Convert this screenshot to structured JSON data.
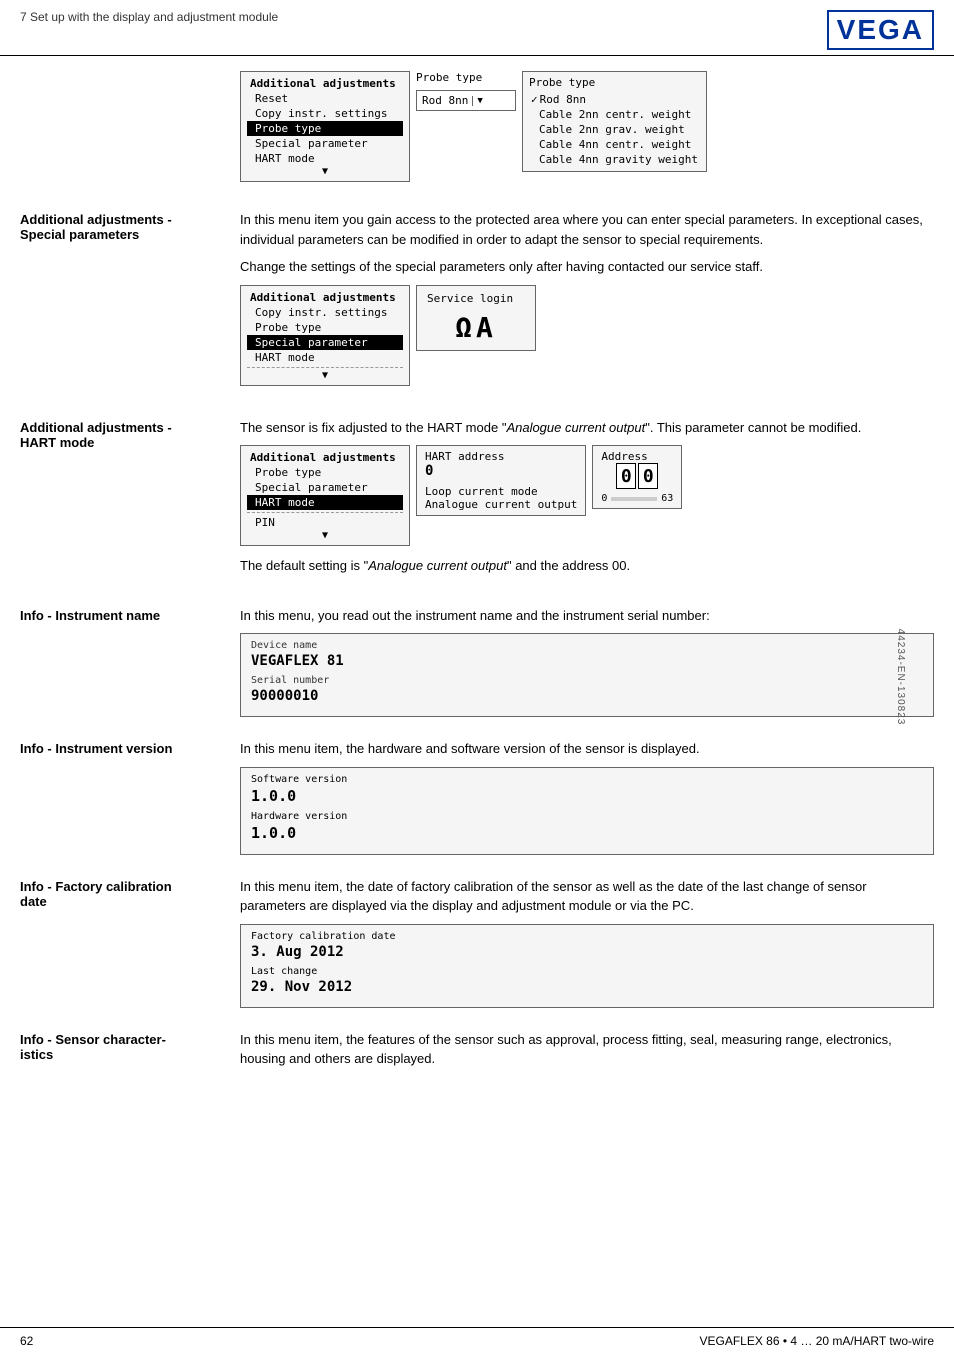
{
  "header": {
    "breadcrumb": "7 Set up with the display and adjustment module",
    "logo": "VEGA"
  },
  "sections": [
    {
      "id": "probe-type",
      "label": "",
      "body_paragraphs": [],
      "has_ui": true,
      "ui_type": "probe-type-row"
    },
    {
      "id": "special-parameters",
      "label_line1": "Additional adjustments -",
      "label_line2": "Special parameters",
      "paragraphs": [
        "In this menu item you gain access to the protected area where you can enter special parameters. In exceptional cases, individual parameters can be modified in order to adapt the sensor to special requirements.",
        "Change the settings of the special parameters only after having contacted our service staff."
      ],
      "has_ui": true,
      "ui_type": "service-login-row"
    },
    {
      "id": "hart-mode",
      "label_line1": "Additional adjustments -",
      "label_line2": "HART mode",
      "paragraphs": [
        "The sensor is fix adjusted to the HART mode \"Analogue current output\". This parameter cannot be modified."
      ],
      "has_ui": true,
      "ui_type": "hart-row",
      "note": "The default setting is \"Analogue current output\" and the address 00."
    },
    {
      "id": "instrument-name",
      "label": "Info - Instrument name",
      "paragraphs": [
        "In this menu, you read out the instrument name and the instrument serial number:"
      ],
      "has_ui": true,
      "ui_type": "device-name-row"
    },
    {
      "id": "instrument-version",
      "label": "Info - Instrument version",
      "paragraphs": [
        "In this menu item, the hardware and software version of the sensor is displayed."
      ],
      "has_ui": true,
      "ui_type": "version-row"
    },
    {
      "id": "factory-cal",
      "label_line1": "Info - Factory calibration",
      "label_line2": "date",
      "paragraphs": [
        "In this menu item, the date of factory calibration of the sensor as well as the date of the last change of sensor parameters are displayed via the display and adjustment module or via the PC."
      ],
      "has_ui": true,
      "ui_type": "calibration-row"
    },
    {
      "id": "sensor-char",
      "label_line1": "Info - Sensor character-",
      "label_line2": "istics",
      "paragraphs": [
        "In this menu item, the features of the sensor such as approval, process fitting, seal, measuring range, electronics, housing and others are displayed."
      ],
      "has_ui": false
    }
  ],
  "probe_type_menu": {
    "title": "Additional adjustments",
    "items": [
      "Reset",
      "Copy instr. settings",
      "Probe type",
      "Special parameter",
      "HART mode"
    ],
    "selected": "Probe type"
  },
  "probe_type_center": {
    "label": "Probe type",
    "value": "Rod 8nn"
  },
  "probe_type_options": {
    "label": "Probe type",
    "options": [
      "Rod 8nn",
      "Cable 2nn centr. weight",
      "Cable 2nn grav. weight",
      "Cable 4nn centr. weight",
      "Cable 4nn gravity weight"
    ],
    "checked": "Rod 8nn"
  },
  "service_menu": {
    "title": "Additional adjustments",
    "items": [
      "Copy instr. settings",
      "Probe type",
      "Special parameter",
      "HART mode"
    ],
    "selected": "Special parameter",
    "divider": true
  },
  "service_login": {
    "label": "Service login",
    "icon": "ᴮᴬ",
    "icon_display": "ΩA"
  },
  "hart_menu": {
    "title": "Additional adjustments",
    "items": [
      "Probe type",
      "Special parameter",
      "HART mode"
    ],
    "selected": "HART mode",
    "extra": "PIN"
  },
  "hart_center": {
    "label": "HART address",
    "value": "0",
    "sub_items": [
      "Loop current mode",
      "Analogue current output"
    ]
  },
  "hart_address": {
    "label": "Address",
    "digits": [
      "0",
      "0"
    ],
    "slider_min": "0",
    "slider_max": "63"
  },
  "device_name": {
    "name_label": "Device name",
    "name_value": "VEGAFLEX 81",
    "serial_label": "Serial number",
    "serial_value": "90000010"
  },
  "version": {
    "sw_label": "Software version",
    "sw_value": "1.0.0",
    "hw_label": "Hardware version",
    "hw_value": "1.0.0"
  },
  "calibration": {
    "date_label": "Factory calibration date",
    "date_value": "3. Aug    2012",
    "change_label": "Last change",
    "change_value": "29. Nov    2012"
  },
  "footer": {
    "page_number": "62",
    "product": "VEGAFLEX 86 • 4 … 20 mA/HART two-wire"
  },
  "side_doc": "44234-EN-130823"
}
